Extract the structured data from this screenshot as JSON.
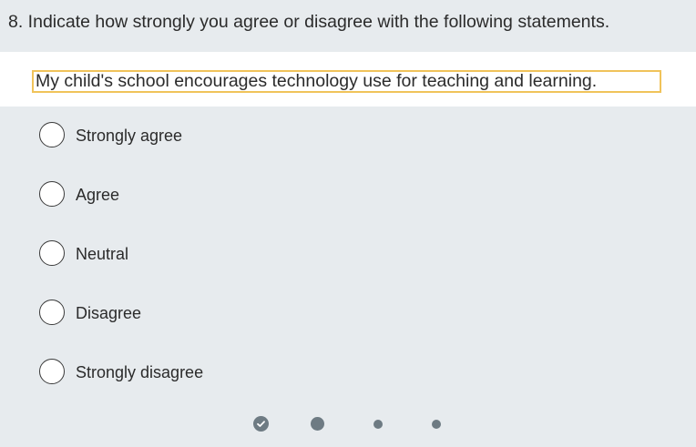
{
  "question": {
    "title": "8. Indicate how strongly you agree or disagree with the following statements."
  },
  "statement": {
    "text": "My child's school encourages technology use for teaching and learning."
  },
  "options": [
    {
      "label": "Strongly agree",
      "selected": false
    },
    {
      "label": "Agree",
      "selected": false
    },
    {
      "label": "Neutral",
      "selected": false
    },
    {
      "label": "Disagree",
      "selected": false
    },
    {
      "label": "Strongly disagree",
      "selected": false
    }
  ],
  "pager": {
    "steps": [
      {
        "state": "completed",
        "icon": "check-icon"
      },
      {
        "state": "current"
      },
      {
        "state": "upcoming"
      },
      {
        "state": "upcoming"
      }
    ]
  },
  "colors": {
    "panel_background": "#e7ebee",
    "focus_outline": "#f0c35a",
    "pager_dot": "#6e7b83"
  }
}
